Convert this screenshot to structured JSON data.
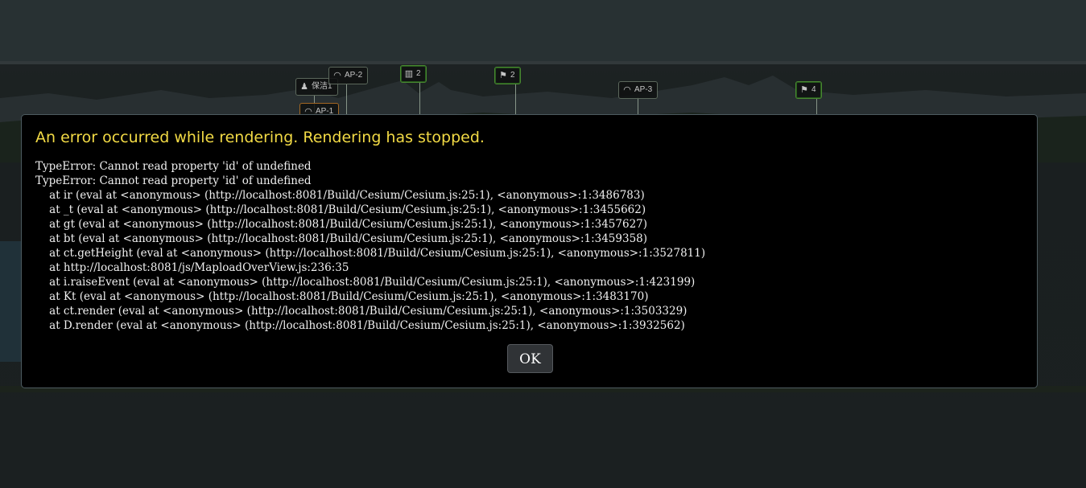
{
  "scene": {
    "markers": [
      {
        "icon": "person-icon",
        "label": "保洁1"
      },
      {
        "icon": "wifi-icon",
        "label": "AP-2"
      },
      {
        "icon": "trash-icon",
        "label": "2"
      },
      {
        "icon": "flag-icon",
        "label": "2"
      },
      {
        "icon": "wifi-icon",
        "label": "AP-3"
      },
      {
        "icon": "flag-icon",
        "label": "4"
      },
      {
        "icon": "wifi-icon",
        "label": "AP-1"
      }
    ]
  },
  "dialog": {
    "title": "An error occurred while rendering. Rendering has stopped.",
    "message_lines": [
      "TypeError: Cannot read property 'id' of undefined",
      "TypeError: Cannot read property 'id' of undefined",
      "    at ir (eval at <anonymous> (http://localhost:8081/Build/Cesium/Cesium.js:25:1), <anonymous>:1:3486783)",
      "    at _t (eval at <anonymous> (http://localhost:8081/Build/Cesium/Cesium.js:25:1), <anonymous>:1:3455662)",
      "    at gt (eval at <anonymous> (http://localhost:8081/Build/Cesium/Cesium.js:25:1), <anonymous>:1:3457627)",
      "    at bt (eval at <anonymous> (http://localhost:8081/Build/Cesium/Cesium.js:25:1), <anonymous>:1:3459358)",
      "    at ct.getHeight (eval at <anonymous> (http://localhost:8081/Build/Cesium/Cesium.js:25:1), <anonymous>:1:3527811)",
      "    at http://localhost:8081/js/MaploadOverView.js:236:35",
      "    at i.raiseEvent (eval at <anonymous> (http://localhost:8081/Build/Cesium/Cesium.js:25:1), <anonymous>:1:423199)",
      "    at Kt (eval at <anonymous> (http://localhost:8081/Build/Cesium/Cesium.js:25:1), <anonymous>:1:3483170)",
      "    at ct.render (eval at <anonymous> (http://localhost:8081/Build/Cesium/Cesium.js:25:1), <anonymous>:1:3503329)",
      "    at D.render (eval at <anonymous> (http://localhost:8081/Build/Cesium/Cesium.js:25:1), <anonymous>:1:3932562)"
    ],
    "ok_label": "OK"
  },
  "colors": {
    "title": "#f2da45",
    "dialog_bg": "#000000",
    "button_bg": "#303336"
  }
}
